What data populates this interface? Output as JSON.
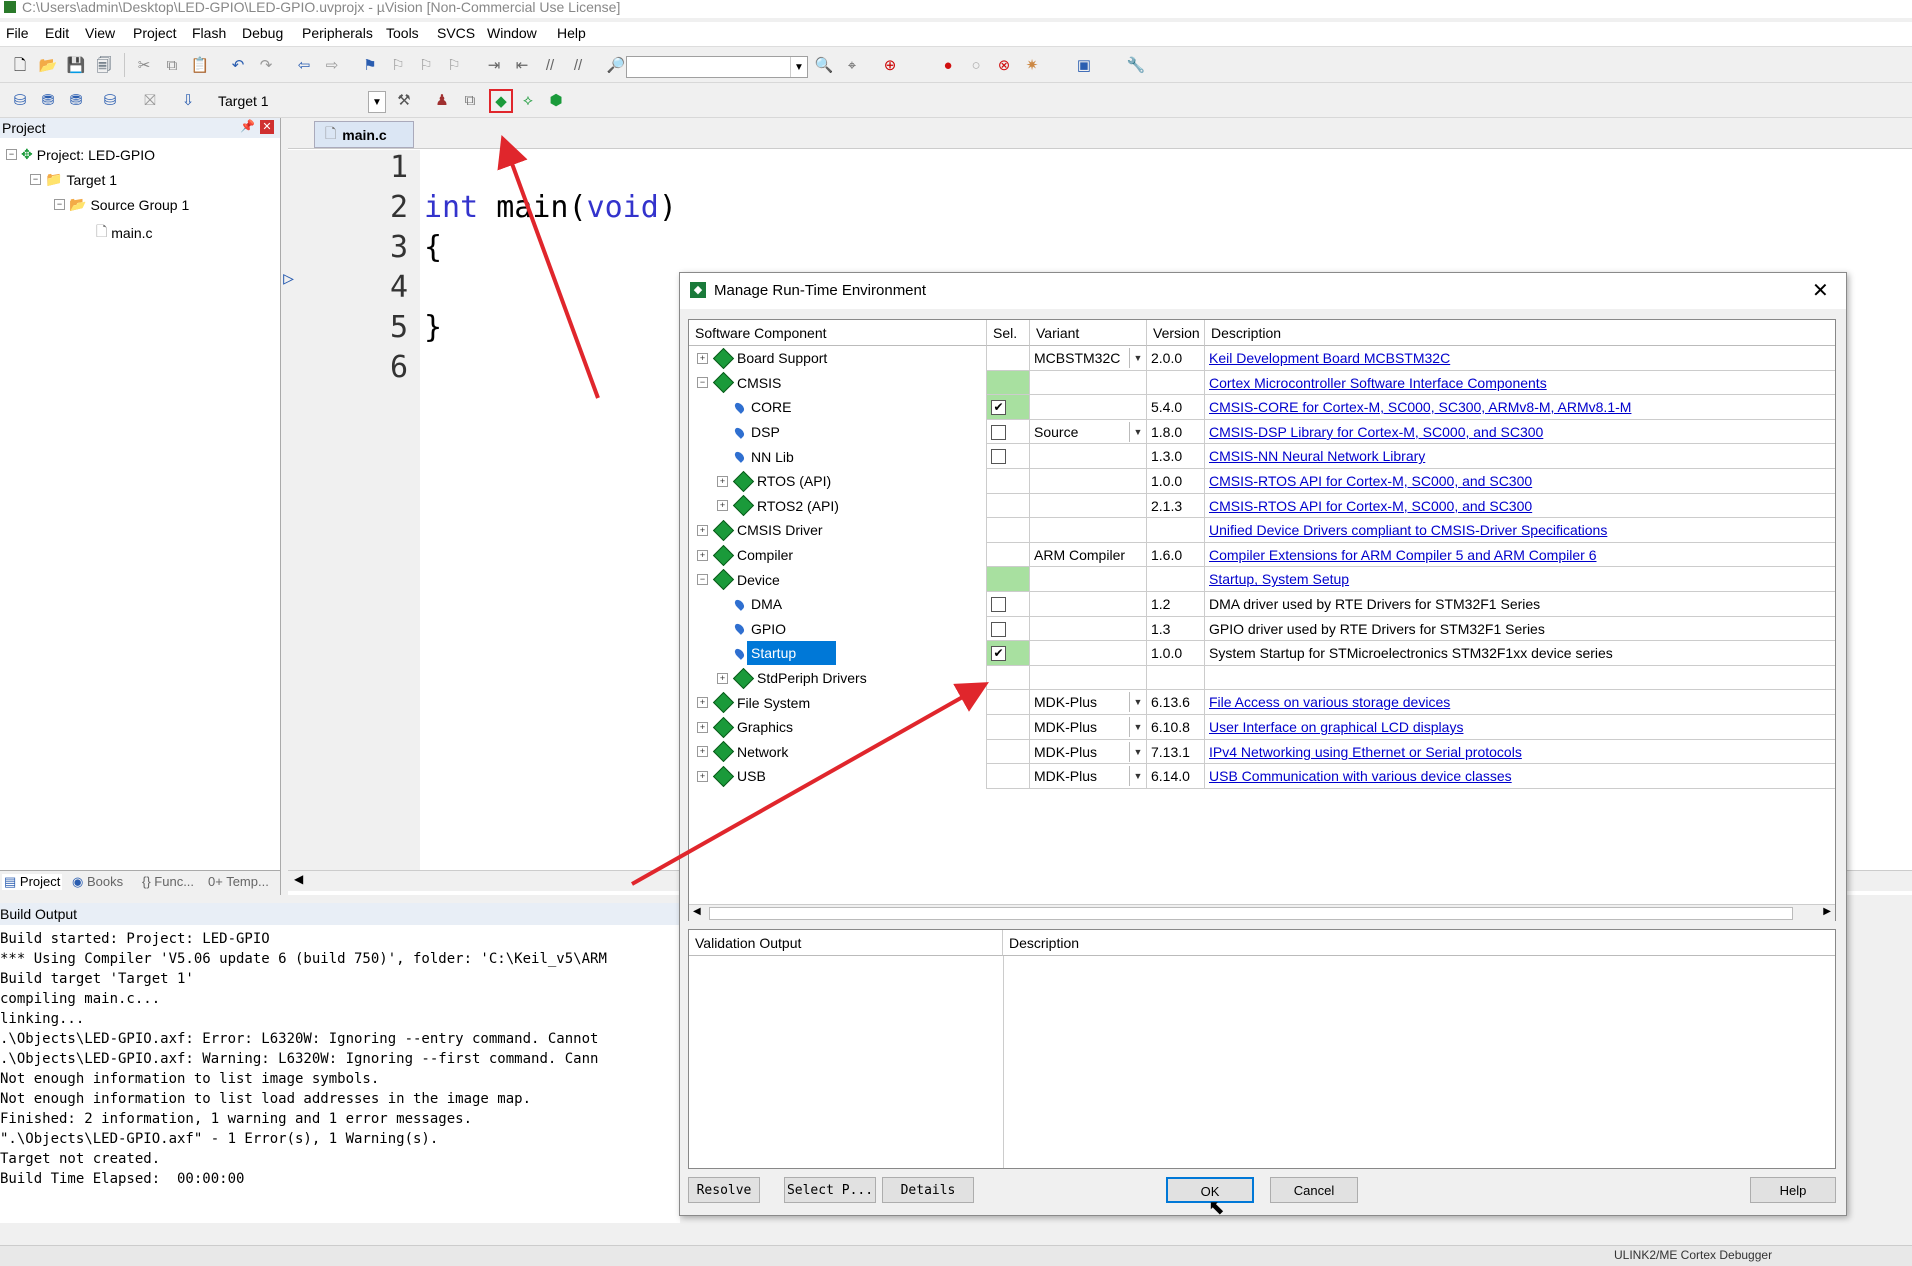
{
  "window": {
    "title": "C:\\Users\\admin\\Desktop\\LED-GPIO\\LED-GPIO.uvprojx - µVision  [Non-Commercial Use License]"
  },
  "menu": [
    "File",
    "Edit",
    "View",
    "Project",
    "Flash",
    "Debug",
    "Peripherals",
    "Tools",
    "SVCS",
    "Window",
    "Help"
  ],
  "toolbar": {
    "target_value": "Target 1"
  },
  "project_panel": {
    "header": "Project",
    "project": "Project: LED-GPIO",
    "target": "Target 1",
    "group": "Source Group 1",
    "file": "main.c",
    "tabs": [
      "Project",
      "Books",
      "{} Func...",
      "0+ Temp..."
    ]
  },
  "editor": {
    "tab": "main.c",
    "line_numbers": [
      "1",
      "2",
      "3",
      "4",
      "5",
      "6"
    ],
    "code": {
      "line2_kw": "int",
      "line2_mid": " main(",
      "line2_arg": "void",
      "line2_end": ")",
      "line3": "{",
      "line5": "}"
    }
  },
  "build_output": {
    "header": "Build Output",
    "lines": [
      "Build started: Project: LED-GPIO",
      "*** Using Compiler 'V5.06 update 6 (build 750)', folder: 'C:\\Keil_v5\\ARM",
      "Build target 'Target 1'",
      "compiling main.c...",
      "linking...",
      ".\\Objects\\LED-GPIO.axf: Error: L6320W: Ignoring --entry command. Cannot",
      ".\\Objects\\LED-GPIO.axf: Warning: L6320W: Ignoring --first command. Cann",
      "Not enough information to list image symbols.",
      "Not enough information to list load addresses in the image map.",
      "Finished: 2 information, 1 warning and 1 error messages.",
      "\".\\Objects\\LED-GPIO.axf\" - 1 Error(s), 1 Warning(s).",
      "Target not created.",
      "Build Time Elapsed:  00:00:00"
    ]
  },
  "status_bar": {
    "debugger": "ULINK2/ME Cortex Debugger"
  },
  "dialog": {
    "title": "Manage Run-Time Environment",
    "columns": [
      "Software Component",
      "Sel.",
      "Variant",
      "Version",
      "Description"
    ],
    "rows": [
      {
        "name": "Board Support",
        "variant": "MCBSTM32C",
        "version": "2.0.0",
        "desc": "Keil Development Board MCBSTM32C"
      },
      {
        "name": "CMSIS",
        "variant": "",
        "version": "",
        "desc": "Cortex Microcontroller Software Interface Components"
      },
      {
        "name": "CORE",
        "variant": "",
        "version": "5.4.0",
        "desc": "CMSIS-CORE for Cortex-M, SC000, SC300, ARMv8-M, ARMv8.1-M"
      },
      {
        "name": "DSP",
        "variant": "Source",
        "version": "1.8.0",
        "desc": "CMSIS-DSP Library for Cortex-M, SC000, and SC300"
      },
      {
        "name": "NN Lib",
        "variant": "",
        "version": "1.3.0",
        "desc": "CMSIS-NN Neural Network Library"
      },
      {
        "name": "RTOS (API)",
        "variant": "",
        "version": "1.0.0",
        "desc": "CMSIS-RTOS API for Cortex-M, SC000, and SC300"
      },
      {
        "name": "RTOS2 (API)",
        "variant": "",
        "version": "2.1.3",
        "desc": "CMSIS-RTOS API for Cortex-M, SC000, and SC300"
      },
      {
        "name": "CMSIS Driver",
        "variant": "",
        "version": "",
        "desc": "Unified Device Drivers compliant to CMSIS-Driver Specifications"
      },
      {
        "name": "Compiler",
        "variant": "ARM Compiler",
        "version": "1.6.0",
        "desc": "Compiler Extensions for ARM Compiler 5 and ARM Compiler 6"
      },
      {
        "name": "Device",
        "variant": "",
        "version": "",
        "desc": "Startup, System Setup"
      },
      {
        "name": "DMA",
        "variant": "",
        "version": "1.2",
        "desc": "DMA driver used by RTE Drivers for STM32F1 Series"
      },
      {
        "name": "GPIO",
        "variant": "",
        "version": "1.3",
        "desc": "GPIO driver used by RTE Drivers for STM32F1 Series"
      },
      {
        "name": "Startup",
        "variant": "",
        "version": "1.0.0",
        "desc": "System Startup for STMicroelectronics STM32F1xx device series"
      },
      {
        "name": "StdPeriph Drivers",
        "variant": "",
        "version": "",
        "desc": ""
      },
      {
        "name": "File System",
        "variant": "MDK-Plus",
        "version": "6.13.6",
        "desc": "File Access on various storage devices"
      },
      {
        "name": "Graphics",
        "variant": "MDK-Plus",
        "version": "6.10.8",
        "desc": "User Interface on graphical LCD displays"
      },
      {
        "name": "Network",
        "variant": "MDK-Plus",
        "version": "7.13.1",
        "desc": "IPv4 Networking using Ethernet or Serial protocols"
      },
      {
        "name": "USB",
        "variant": "MDK-Plus",
        "version": "6.14.0",
        "desc": "USB Communication with various device classes"
      }
    ],
    "validation_columns": [
      "Validation Output",
      "Description"
    ],
    "buttons": {
      "resolve": "Resolve",
      "select": "Select P...",
      "details": "Details",
      "ok": "OK",
      "cancel": "Cancel",
      "help": "Help"
    }
  }
}
